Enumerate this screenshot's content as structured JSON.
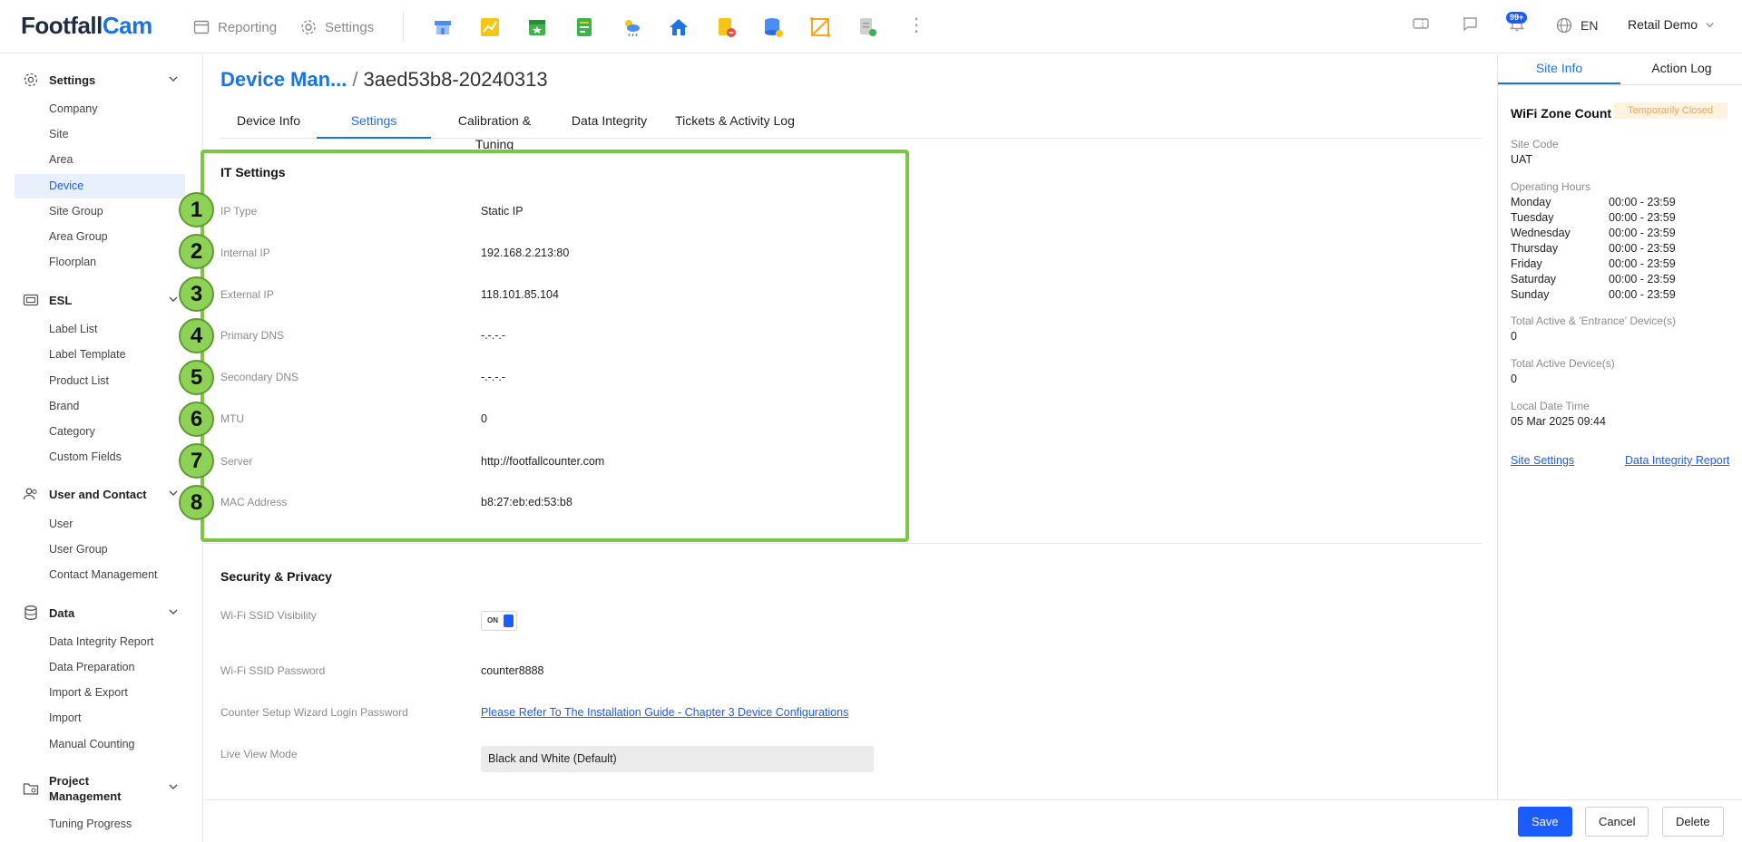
{
  "app": {
    "logo_part1": "Footfall",
    "logo_part2": "Cam"
  },
  "topnav": {
    "reporting": "Reporting",
    "settings": "Settings"
  },
  "header": {
    "notification_badge": "99+",
    "language": "EN",
    "user": "Retail Demo"
  },
  "sidebar": {
    "sections": [
      {
        "label": "Settings",
        "items": [
          "Company",
          "Site",
          "Area",
          "Device",
          "Site Group",
          "Area Group",
          "Floorplan"
        ]
      },
      {
        "label": "ESL",
        "items": [
          "Label List",
          "Label Template",
          "Product List",
          "Brand",
          "Category",
          "Custom Fields"
        ]
      },
      {
        "label": "User and Contact",
        "items": [
          "User",
          "User Group",
          "Contact Management"
        ]
      },
      {
        "label": "Data",
        "items": [
          "Data Integrity Report",
          "Data Preparation",
          "Import & Export",
          "Import",
          "Manual Counting"
        ]
      },
      {
        "label_line1": "Project",
        "label_line2": "Management",
        "items": [
          "Tuning Progress"
        ]
      }
    ],
    "active_item": "Device"
  },
  "breadcrumb": {
    "parent": "Device Man...",
    "separator": "/",
    "current": "3aed53b8-20240313"
  },
  "tabs": [
    "Device Info",
    "Settings",
    "Calibration & Tuning",
    "Data Integrity",
    "Tickets & Activity Log"
  ],
  "active_tab": "Settings",
  "it_settings": {
    "title": "IT Settings",
    "rows": [
      {
        "num": "1",
        "label": "IP Type",
        "value": "Static IP"
      },
      {
        "num": "2",
        "label": "Internal IP",
        "value": "192.168.2.213:80"
      },
      {
        "num": "3",
        "label": "External IP",
        "value": "118.101.85.104"
      },
      {
        "num": "4",
        "label": "Primary DNS",
        "value": "-.-.-.-"
      },
      {
        "num": "5",
        "label": "Secondary DNS",
        "value": "-.-.-.-"
      },
      {
        "num": "6",
        "label": "MTU",
        "value": "0"
      },
      {
        "num": "7",
        "label": "Server",
        "value": "http://footfallcounter.com"
      },
      {
        "num": "8",
        "label": "MAC Address",
        "value": "b8:27:eb:ed:53:b8"
      }
    ]
  },
  "security": {
    "title": "Security & Privacy",
    "ssid_visibility_label": "Wi-Fi SSID Visibility",
    "ssid_visibility_toggle": "ON",
    "ssid_password_label": "Wi-Fi SSID Password",
    "ssid_password_value": "counter8888",
    "wizard_label": "Counter Setup Wizard Login Password",
    "wizard_link": "Please Refer To The Installation Guide - Chapter 3 Device Configurations",
    "live_view_label": "Live View Mode",
    "live_view_value": "Black and White (Default)"
  },
  "footer": {
    "save": "Save",
    "cancel": "Cancel",
    "delete": "Delete"
  },
  "right_panel": {
    "tabs": [
      "Site Info",
      "Action Log"
    ],
    "active_tab": "Site Info",
    "site_name": "WiFi Zone Count",
    "status_badge": "Temporarily Closed",
    "site_code_label": "Site Code",
    "site_code_value": "UAT",
    "hours_label": "Operating Hours",
    "hours": [
      {
        "day": "Monday",
        "time": "00:00 - 23:59"
      },
      {
        "day": "Tuesday",
        "time": "00:00 - 23:59"
      },
      {
        "day": "Wednesday",
        "time": "00:00 - 23:59"
      },
      {
        "day": "Thursday",
        "time": "00:00 - 23:59"
      },
      {
        "day": "Friday",
        "time": "00:00 - 23:59"
      },
      {
        "day": "Saturday",
        "time": "00:00 - 23:59"
      },
      {
        "day": "Sunday",
        "time": "00:00 - 23:59"
      }
    ],
    "active_entrance_label": "Total Active & 'Entrance' Device(s)",
    "active_entrance_value": "0",
    "active_devices_label": "Total Active Device(s)",
    "active_devices_value": "0",
    "local_time_label": "Local Date Time",
    "local_time_value": "05 Mar 2025 09:44",
    "site_settings_link": "Site Settings",
    "data_integrity_link": "Data Integrity Report"
  },
  "colors": {
    "brand_blue": "#1a73e8",
    "primary_button": "#1a5cff",
    "highlight_green": "#7cc644",
    "badge_orange": "#f0a35a"
  }
}
